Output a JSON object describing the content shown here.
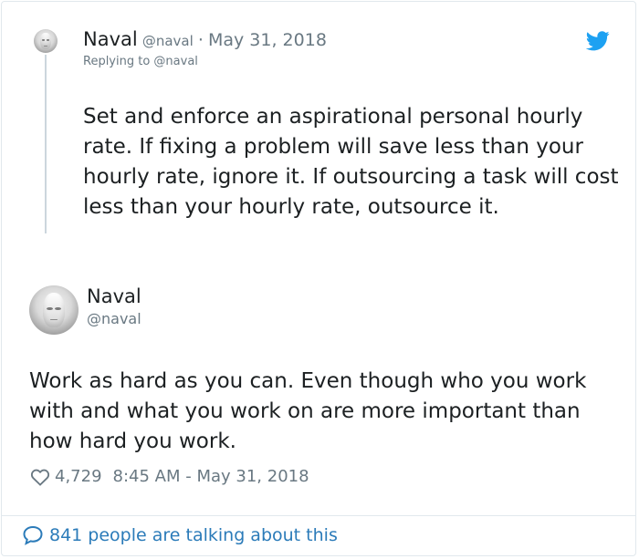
{
  "reply": {
    "author_name": "Naval",
    "author_handle": "@naval",
    "separator": "·",
    "date": "May 31, 2018",
    "replying_to": "Replying to @naval",
    "text": "Set and enforce an aspirational personal hourly rate. If fixing a problem will save less than your hourly rate, ignore it. If outsourcing a task will cost less than your hourly rate, outsource it."
  },
  "tweet": {
    "author_name": "Naval",
    "author_handle": "@naval",
    "text": "Work as hard as you can. Even though who you work with and what you work on are more important than how hard you work.",
    "likes": "4,729",
    "timestamp": "8:45 AM - May 31, 2018"
  },
  "footer": {
    "talking": "841 people are talking about this"
  },
  "colors": {
    "accent": "#1da1f2",
    "link": "#2b7bb9",
    "muted": "#697882",
    "text": "#1c2022",
    "border": "#e1e8ed"
  },
  "icons": {
    "brand": "twitter-bird-icon",
    "like": "heart-outline-icon",
    "reply": "speech-bubble-icon"
  }
}
